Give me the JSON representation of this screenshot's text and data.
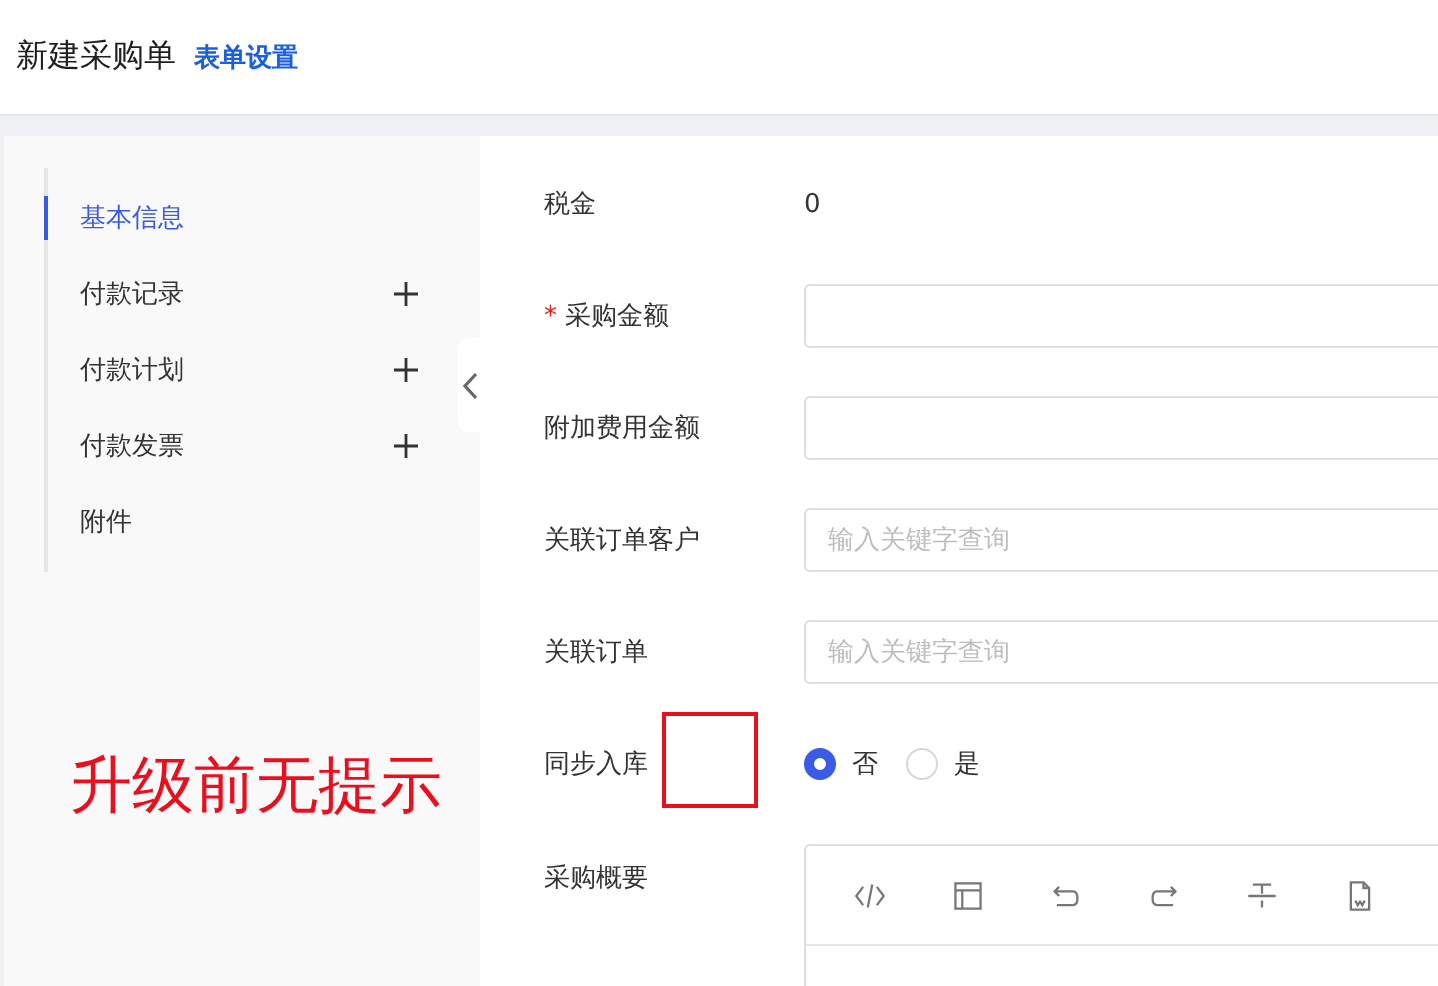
{
  "header": {
    "title": "新建采购单",
    "link": "表单设置"
  },
  "sidebar": {
    "items": [
      {
        "label": "基本信息",
        "selected": true,
        "addable": false
      },
      {
        "label": "付款记录",
        "selected": false,
        "addable": true
      },
      {
        "label": "付款计划",
        "selected": false,
        "addable": true
      },
      {
        "label": "付款发票",
        "selected": false,
        "addable": true
      },
      {
        "label": "附件",
        "selected": false,
        "addable": false
      }
    ]
  },
  "form": {
    "fields": [
      {
        "kind": "text",
        "label": "税金",
        "value": "0"
      },
      {
        "kind": "input",
        "label": "采购金额",
        "required_mark": "*"
      },
      {
        "kind": "input",
        "label": "附加费用金额"
      },
      {
        "kind": "input",
        "label": "关联订单客户",
        "placeholder": "输入关键字查询"
      },
      {
        "kind": "input",
        "label": "关联订单",
        "placeholder": "输入关键字查询"
      },
      {
        "kind": "radio",
        "label": "同步入库",
        "options": [
          {
            "label": "否",
            "selected": true
          },
          {
            "label": "是",
            "selected": false
          }
        ]
      },
      {
        "kind": "editor",
        "label": "采购概要"
      }
    ]
  },
  "annotation": {
    "text": "升级前无提示"
  }
}
